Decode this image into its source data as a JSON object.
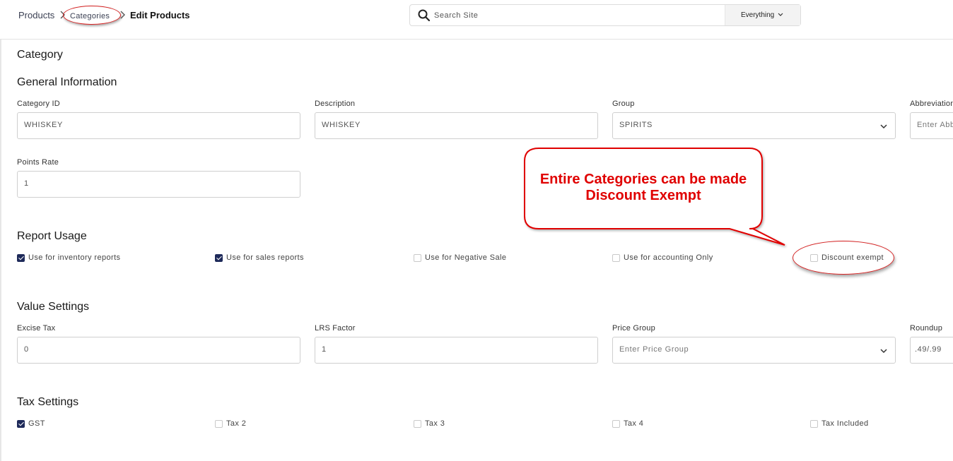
{
  "breadcrumb": {
    "products": "Products",
    "categories": "Categories",
    "current": "Edit Products"
  },
  "search": {
    "placeholder": "Search Site",
    "scope": "Everything"
  },
  "page_title": "Category",
  "general": {
    "title": "General Information",
    "category_id": {
      "label": "Category ID",
      "value": "WHISKEY"
    },
    "description": {
      "label": "Description",
      "value": "WHISKEY"
    },
    "group": {
      "label": "Group",
      "value": "SPIRITS"
    },
    "abbreviation": {
      "label": "Abbreviation",
      "placeholder": "Enter Abb"
    },
    "points_rate": {
      "label": "Points Rate",
      "value": "1"
    }
  },
  "report_usage": {
    "title": "Report Usage",
    "items": [
      {
        "label": "Use for inventory reports",
        "checked": true
      },
      {
        "label": "Use for sales reports",
        "checked": true
      },
      {
        "label": "Use for Negative Sale",
        "checked": false
      },
      {
        "label": "Use for accounting Only",
        "checked": false
      },
      {
        "label": "Discount exempt",
        "checked": false
      }
    ]
  },
  "value_settings": {
    "title": "Value Settings",
    "excise_tax": {
      "label": "Excise Tax",
      "value": "0"
    },
    "lrs_factor": {
      "label": "LRS Factor",
      "value": "1"
    },
    "price_group": {
      "label": "Price Group",
      "placeholder": "Enter Price Group"
    },
    "roundup": {
      "label": "Roundup",
      "value": ".49/.99"
    }
  },
  "tax_settings": {
    "title": "Tax Settings",
    "items": [
      {
        "label": "GST",
        "checked": true
      },
      {
        "label": "Tax 2",
        "checked": false
      },
      {
        "label": "Tax 3",
        "checked": false
      },
      {
        "label": "Tax 4",
        "checked": false
      },
      {
        "label": "Tax Included",
        "checked": false
      }
    ]
  },
  "annotation": {
    "line1": "Entire Categories can be made",
    "line2": "Discount Exempt",
    "color": "#e00000"
  },
  "colors": {
    "checkbox_checked": "#1e2a5a",
    "annotation_red": "#d42020"
  }
}
